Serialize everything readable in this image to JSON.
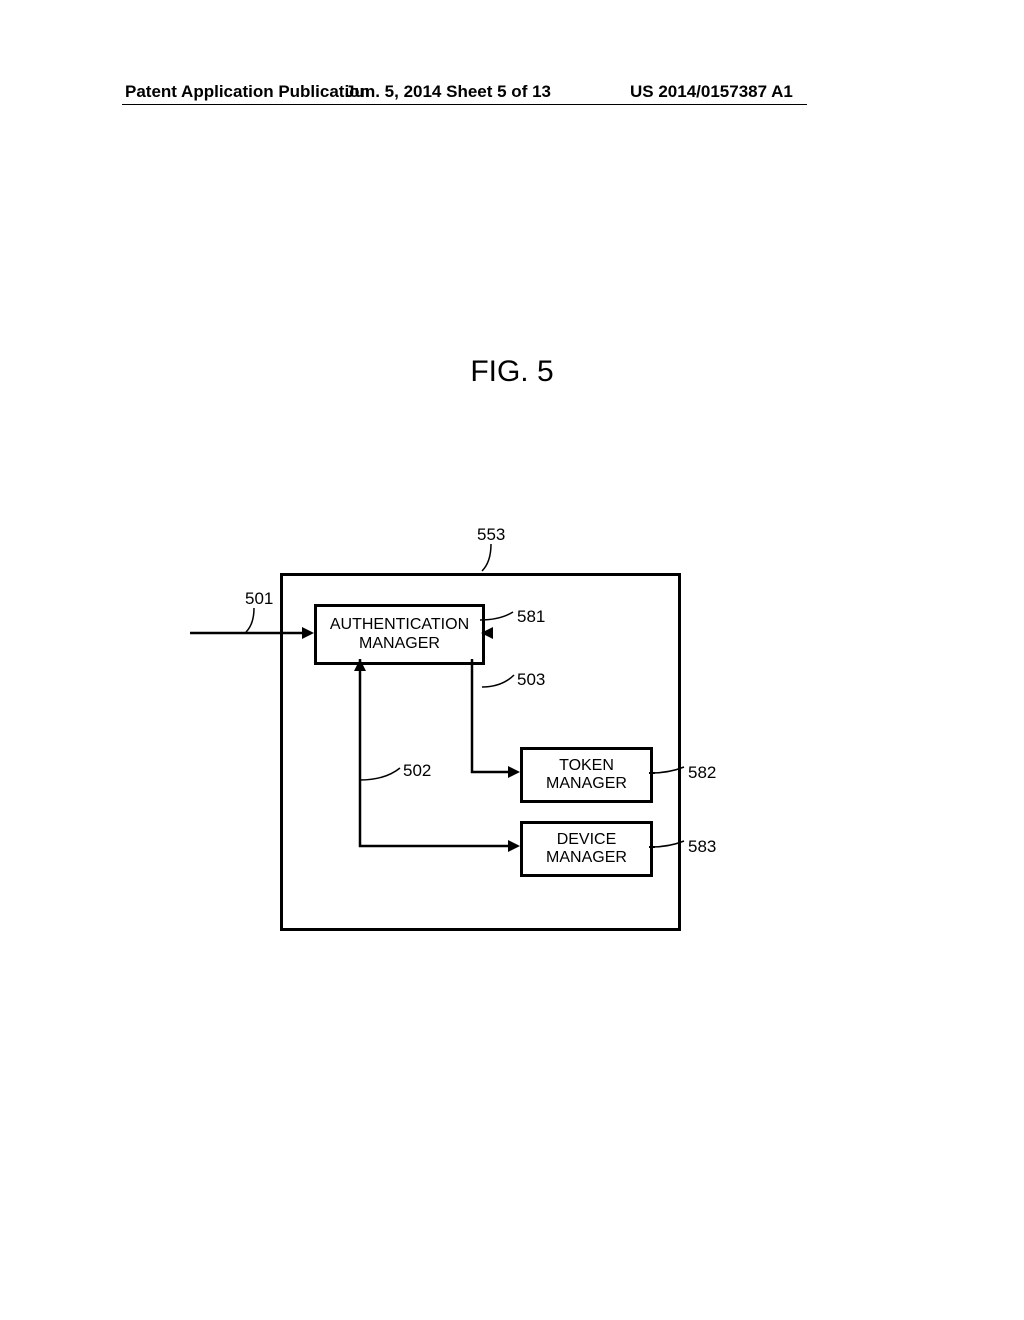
{
  "header": {
    "left": "Patent Application Publication",
    "center": "Jun. 5, 2014   Sheet 5 of 13",
    "right": "US 2014/0157387 A1"
  },
  "figure": {
    "caption": "FIG. 5"
  },
  "diagram": {
    "blocks": {
      "auth": "AUTHENTICATION\nMANAGER",
      "token": "TOKEN\nMANAGER",
      "device": "DEVICE\nMANAGER"
    },
    "refs": {
      "r553": "553",
      "r501": "501",
      "r581": "581",
      "r503": "503",
      "r582": "582",
      "r502": "502",
      "r583": "583"
    }
  }
}
